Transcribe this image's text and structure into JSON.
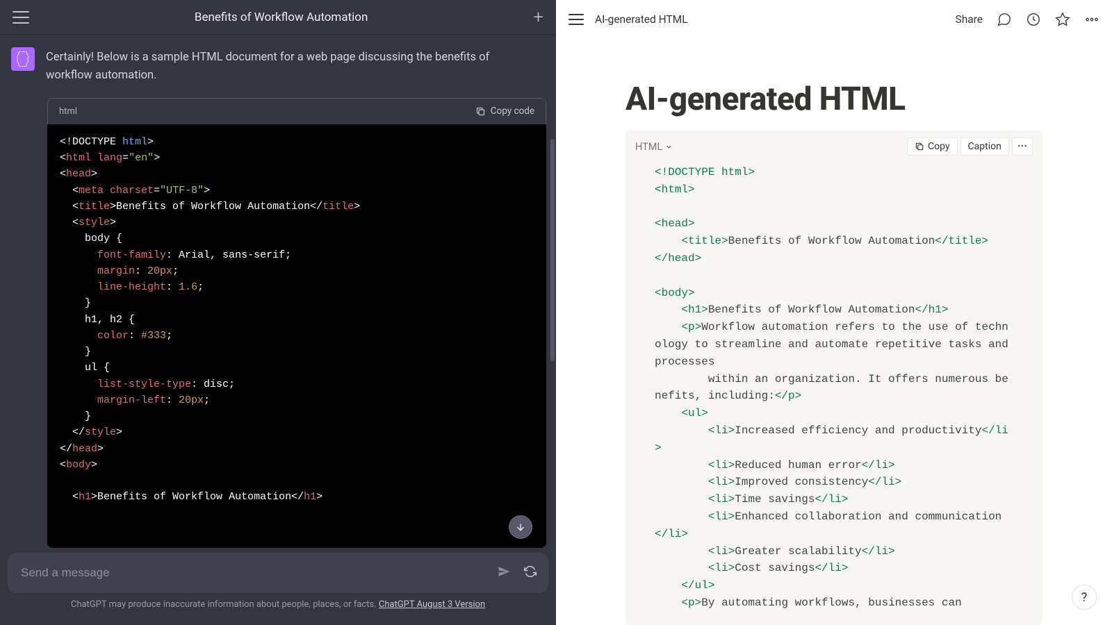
{
  "chat": {
    "title": "Benefits of Workflow Automation",
    "assistant_intro": "Certainly! Below is a sample HTML document for a web page discussing the benefits of workflow automation.",
    "code_lang": "html",
    "copy_label": "Copy code",
    "input_placeholder": "Send a message",
    "disclaimer_text": "ChatGPT may produce inaccurate information about people, places, or facts. ",
    "disclaimer_link": "ChatGPT August 3 Version"
  },
  "code_left": {
    "l1_a": "<!DOCTYPE ",
    "l1_b": "html",
    "l1_c": ">",
    "l2_a": "<",
    "l2_b": "html",
    "l2_c": " lang",
    "l2_d": "=",
    "l2_e": "\"en\"",
    "l2_f": ">",
    "l3_a": "<",
    "l3_b": "head",
    "l3_c": ">",
    "l4_a": "  <",
    "l4_b": "meta",
    "l4_c": " charset",
    "l4_d": "=",
    "l4_e": "\"UTF-8\"",
    "l4_f": ">",
    "l5_a": "  <",
    "l5_b": "title",
    "l5_c": ">Benefits of Workflow Automation</",
    "l5_d": "title",
    "l5_e": ">",
    "l6_a": "  <",
    "l6_b": "style",
    "l6_c": ">",
    "l7": "    body {",
    "l8_a": "      ",
    "l8_b": "font-family",
    "l8_c": ": Arial, sans-serif;",
    "l9_a": "      ",
    "l9_b": "margin",
    "l9_c": ": ",
    "l9_d": "20px",
    "l9_e": ";",
    "l10_a": "      ",
    "l10_b": "line-height",
    "l10_c": ": ",
    "l10_d": "1.6",
    "l10_e": ";",
    "l11": "    }",
    "l12": "    h1, h2 {",
    "l13_a": "      ",
    "l13_b": "color",
    "l13_c": ": ",
    "l13_d": "#333",
    "l13_e": ";",
    "l14": "    }",
    "l15": "    ul {",
    "l16_a": "      ",
    "l16_b": "list-style-type",
    "l16_c": ": disc;",
    "l17_a": "      ",
    "l17_b": "margin-left",
    "l17_c": ": ",
    "l17_d": "20px",
    "l17_e": ";",
    "l18": "    }",
    "l19_a": "  </",
    "l19_b": "style",
    "l19_c": ">",
    "l20_a": "</",
    "l20_b": "head",
    "l20_c": ">",
    "l21_a": "<",
    "l21_b": "body",
    "l21_c": ">",
    "l22": "",
    "l23_a": "  <",
    "l23_b": "h1",
    "l23_c": ">Benefits of Workflow Automation</",
    "l23_d": "h1",
    "l23_e": ">"
  },
  "notion": {
    "breadcrumb": "AI-generated HTML",
    "share": "Share",
    "page_title": "AI-generated HTML",
    "code_type": "HTML",
    "copy": "Copy",
    "caption": "Caption",
    "help": "?"
  },
  "code_right": {
    "l1_a": "<!DOCTYPE html>",
    "l2_a": "<html>",
    "l3": "",
    "l4_a": "<head>",
    "l5_pre": "    ",
    "l5_a": "<title>",
    "l5_b": "Benefits of Workflow Automation",
    "l5_c": "</title>",
    "l6_a": "</head>",
    "l7": "",
    "l8_a": "<body>",
    "l9_pre": "    ",
    "l9_a": "<h1>",
    "l9_b": "Benefits of Workflow Automation",
    "l9_c": "</h1>",
    "l10_pre": "    ",
    "l10_a": "<p>",
    "l10_b": "Workflow automation refers to the use of technology to streamline and automate repetitive tasks and processes",
    "l11_pre": "        ",
    "l11_b": "within an organization. It offers numerous benefits, including:",
    "l11_c": "</p>",
    "l12_pre": "    ",
    "l12_a": "<ul>",
    "l13_pre": "        ",
    "l13_a": "<li>",
    "l13_b": "Increased efficiency and productivity",
    "l13_c": "</li>",
    "l14_pre": "        ",
    "l14_a": "<li>",
    "l14_b": "Reduced human error",
    "l14_c": "</li>",
    "l15_pre": "        ",
    "l15_a": "<li>",
    "l15_b": "Improved consistency",
    "l15_c": "</li>",
    "l16_pre": "        ",
    "l16_a": "<li>",
    "l16_b": "Time savings",
    "l16_c": "</li>",
    "l17_pre": "        ",
    "l17_a": "<li>",
    "l17_b": "Enhanced collaboration and communication",
    "l17_c": "</li>",
    "l18_pre": "        ",
    "l18_a": "<li>",
    "l18_b": "Greater scalability",
    "l18_c": "</li>",
    "l19_pre": "        ",
    "l19_a": "<li>",
    "l19_b": "Cost savings",
    "l19_c": "</li>",
    "l20_pre": "    ",
    "l20_a": "</ul>",
    "l21_pre": "    ",
    "l21_a": "<p>",
    "l21_b": "By automating workflows, businesses can"
  }
}
